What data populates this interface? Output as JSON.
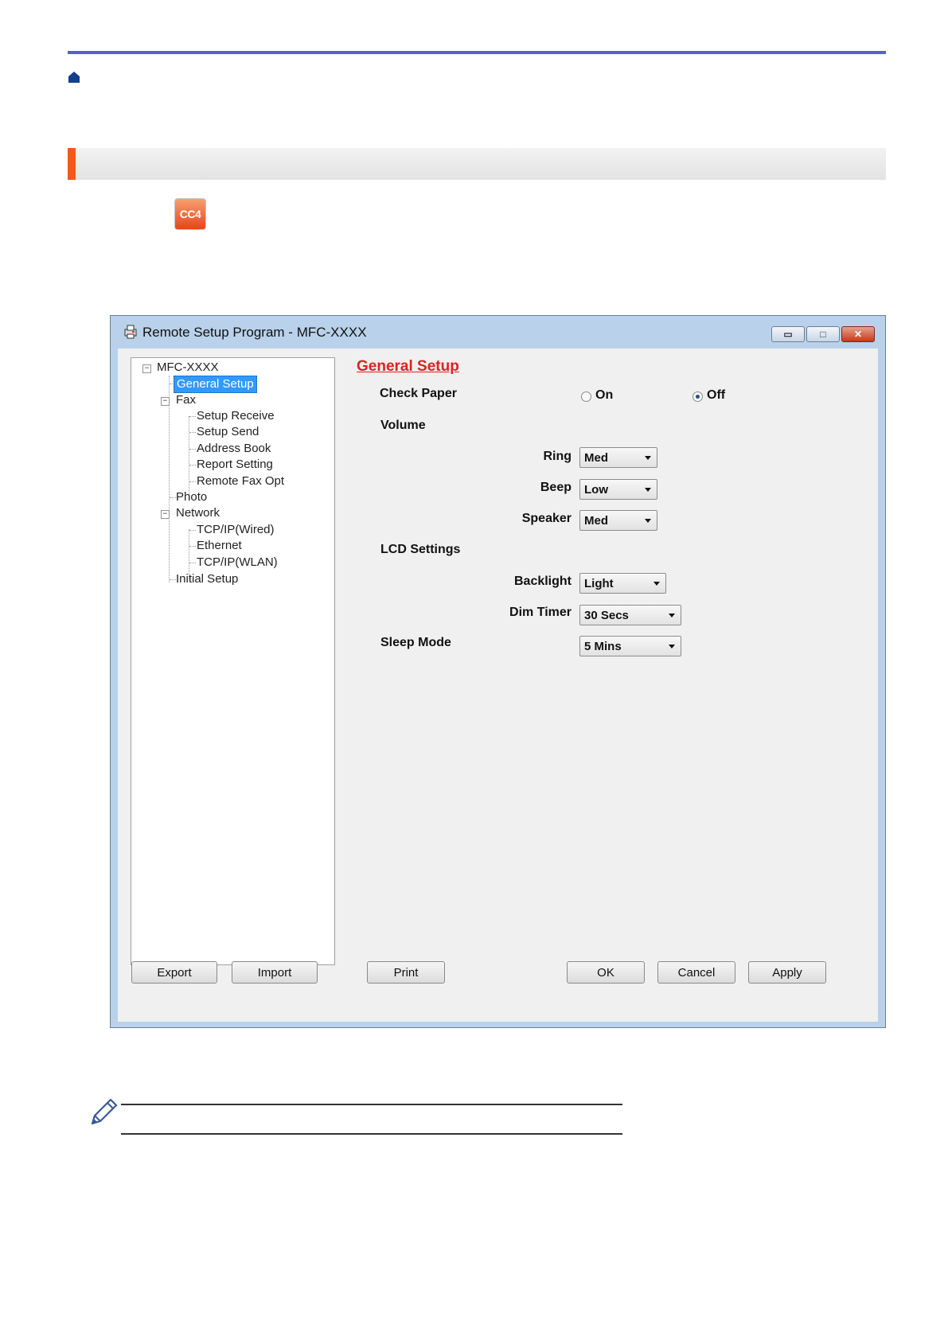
{
  "window": {
    "title": "Remote Setup Program - MFC-XXXX",
    "min_glyph": "▭",
    "max_glyph": "□",
    "close_glyph": "✕"
  },
  "app_icon": {
    "text": "CC4"
  },
  "tree": {
    "root": "MFC-XXXX",
    "nodes": [
      "General Setup",
      "Fax",
      "Setup Receive",
      "Setup Send",
      "Address Book",
      "Report Setting",
      "Remote Fax Opt",
      "Photo",
      "Network",
      "TCP/IP(Wired)",
      "Ethernet",
      "TCP/IP(WLAN)",
      "Initial Setup"
    ]
  },
  "form": {
    "title": "General Setup",
    "check_paper": {
      "label": "Check Paper",
      "on": "On",
      "off": "Off",
      "selected": "Off"
    },
    "volume": {
      "label": "Volume",
      "ring": "Ring",
      "ring_value": "Med",
      "beep": "Beep",
      "beep_value": "Low",
      "speaker": "Speaker",
      "speaker_value": "Med"
    },
    "lcd": {
      "label": "LCD Settings",
      "backlight": "Backlight",
      "backlight_value": "Light",
      "dim_timer": "Dim Timer",
      "dim_timer_value": "30 Secs"
    },
    "sleep": {
      "label": "Sleep Mode",
      "value": "5 Mins"
    }
  },
  "buttons": {
    "export": "Export",
    "import": "Import",
    "print": "Print",
    "ok": "OK",
    "cancel": "Cancel",
    "apply": "Apply"
  },
  "colors": {
    "accent_rule": "#5a5fcf",
    "section_accent": "#f05a1a",
    "form_title": "#e02020",
    "selection": "#3399ff"
  }
}
